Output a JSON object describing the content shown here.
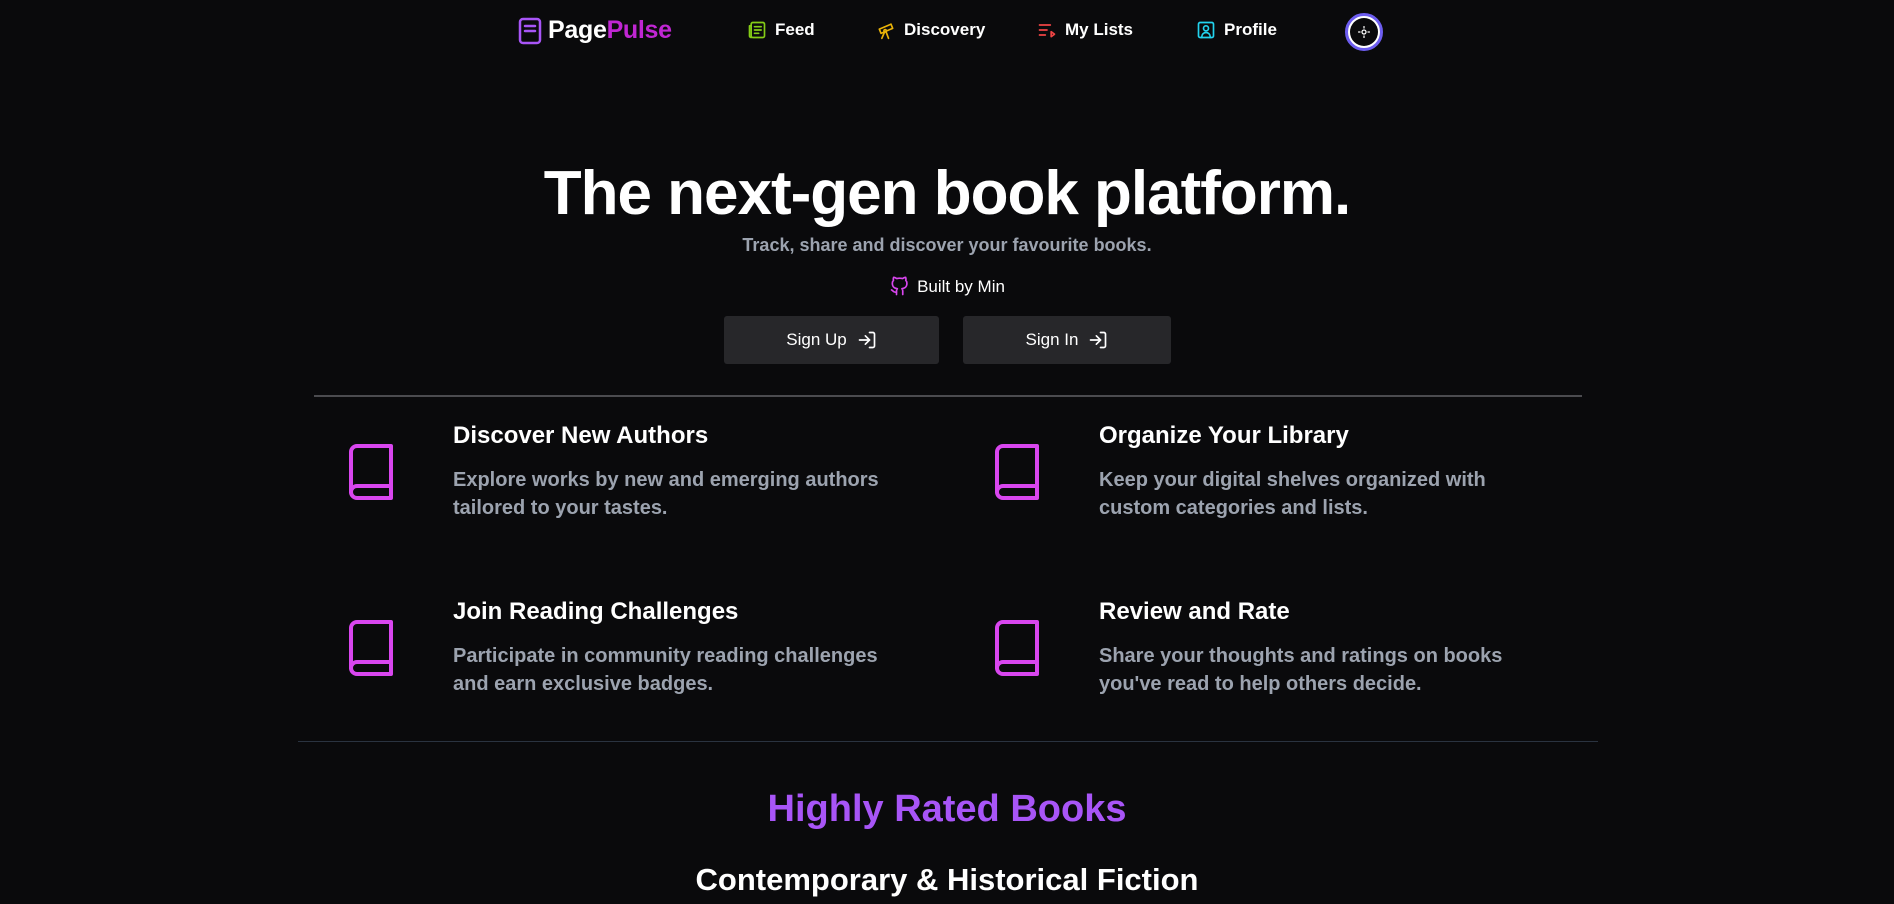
{
  "brand": {
    "name_part1": "Page",
    "name_part2": "Pulse"
  },
  "nav": {
    "feed": "Feed",
    "discovery": "Discovery",
    "my_lists": "My Lists",
    "profile": "Profile"
  },
  "hero": {
    "title": "The next-gen book platform.",
    "subtitle": "Track, share and discover your favourite books.",
    "built_by": "Built by Min",
    "sign_up": "Sign Up",
    "sign_in": "Sign In"
  },
  "features": [
    {
      "title": "Discover New Authors",
      "description": "Explore works by new and emerging authors tailored to your tastes."
    },
    {
      "title": "Organize Your Library",
      "description": "Keep your digital shelves organized with custom categories and lists."
    },
    {
      "title": "Join Reading Challenges",
      "description": "Participate in community reading challenges and earn exclusive badges."
    },
    {
      "title": "Review and Rate",
      "description": "Share your thoughts and ratings on books you've read to help others decide."
    }
  ],
  "highly_rated": {
    "title": "Highly Rated Books",
    "category": "Contemporary & Historical Fiction"
  },
  "colors": {
    "background": "#0a0a0c",
    "brand_accent": "#c026d3",
    "feature_icon": "#d946ef",
    "section_title": "#a855f7",
    "muted_text": "#9ca3af",
    "button_bg": "#27272a"
  },
  "icons": {
    "logo": "notebook-icon",
    "feed": "newspaper-icon",
    "discovery": "telescope-icon",
    "my_lists": "list-icon",
    "profile": "user-square-icon",
    "theme": "sun-icon",
    "built_by": "github-icon",
    "sign_in": "log-in-icon",
    "feature": "book-icon"
  }
}
